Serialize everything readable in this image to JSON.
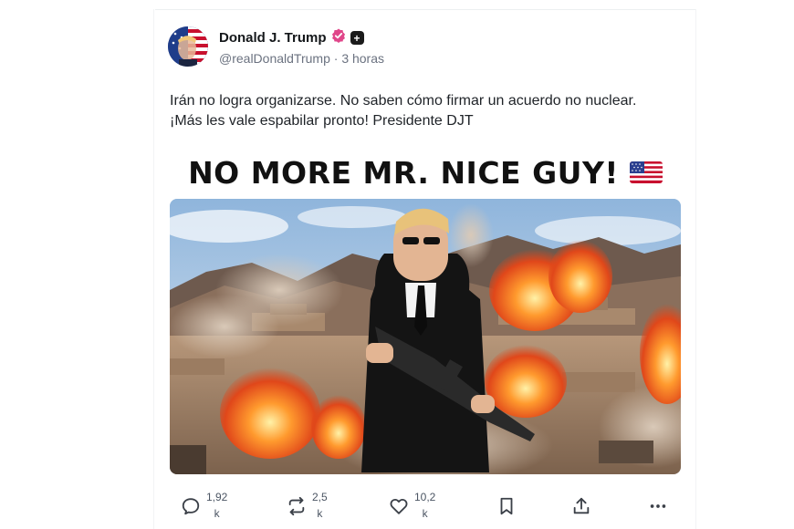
{
  "post": {
    "author_name": "Donald J. Trump",
    "handle": "@realDonaldTrump",
    "separator": "·",
    "time": "3 horas",
    "text_line1": "Irán no logra organizarse. No saben cómo firmar un acuerdo no nuclear.",
    "text_line2": "¡Más les vale espabilar pronto! Presidente DJT",
    "media_headline": "NO MORE MR. NICE GUY!",
    "media_flag_icon": "us-flag-icon",
    "badges": [
      "verified-badge-icon",
      "plus-badge-icon"
    ]
  },
  "actions": {
    "reply": {
      "icon": "reply-icon",
      "count_top": "1,92",
      "count_bottom": "k"
    },
    "repost": {
      "icon": "repost-icon",
      "count_top": "2,5",
      "count_bottom": "k"
    },
    "like": {
      "icon": "heart-icon",
      "count_top": "10,2",
      "count_bottom": "k"
    },
    "bookmark": {
      "icon": "bookmark-icon"
    },
    "share": {
      "icon": "share-icon"
    },
    "more": {
      "icon": "more-icon"
    }
  },
  "colors": {
    "verified_badge": "#e0468a",
    "text_primary": "#14171a",
    "text_muted": "#6b7280"
  }
}
